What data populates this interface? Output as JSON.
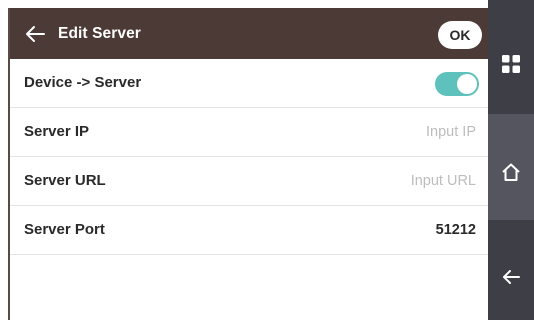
{
  "header": {
    "title": "Edit Server",
    "ok_label": "OK"
  },
  "settings": [
    {
      "label": "Device -> Server",
      "type": "toggle",
      "enabled": true
    },
    {
      "label": "Server IP",
      "type": "input",
      "value": "",
      "placeholder": "Input IP"
    },
    {
      "label": "Server URL",
      "type": "input",
      "value": "",
      "placeholder": "Input URL"
    },
    {
      "label": "Server Port",
      "type": "input",
      "value": "51212"
    }
  ],
  "nav": {
    "items": [
      {
        "icon": "grid-icon"
      },
      {
        "icon": "home-icon"
      },
      {
        "icon": "back-arrow-icon"
      }
    ]
  },
  "colors": {
    "header_bg": "#4b3a35",
    "toggle_on": "#5ec1bb",
    "nav_bg": "#3e3e46",
    "nav_active": "#555560"
  }
}
